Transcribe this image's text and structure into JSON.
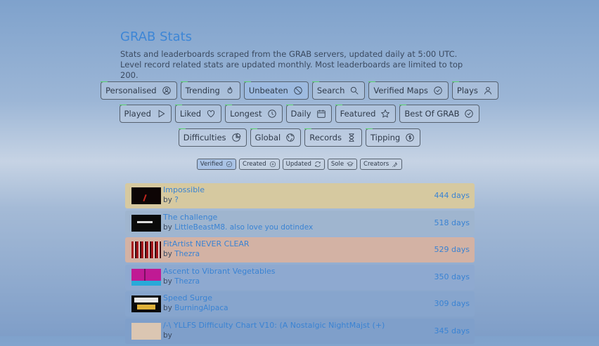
{
  "header": {
    "title": "GRAB Stats",
    "subtitle": "Stats and leaderboards scraped from the GRAB servers, updated daily at 5:00 UTC. Level record related stats are updated monthly. Most leaderboards are limited to top 200."
  },
  "nav": {
    "row1": [
      {
        "label": "Personalised",
        "icon": "user-circle-icon"
      },
      {
        "label": "Trending",
        "icon": "flame-icon"
      },
      {
        "label": "Unbeaten",
        "icon": "ban-icon",
        "active": true
      },
      {
        "label": "Search",
        "icon": "search-icon"
      },
      {
        "label": "Verified Maps",
        "icon": "check-circle-icon"
      },
      {
        "label": "Plays",
        "icon": "user-icon"
      }
    ],
    "row2": [
      {
        "label": "Played",
        "icon": "play-icon"
      },
      {
        "label": "Liked",
        "icon": "heart-icon"
      },
      {
        "label": "Longest",
        "icon": "clock-icon"
      },
      {
        "label": "Daily",
        "icon": "calendar-icon"
      },
      {
        "label": "Featured",
        "icon": "star-icon"
      },
      {
        "label": "Best Of GRAB",
        "icon": "check-circle-icon"
      }
    ],
    "row3": [
      {
        "label": "Difficulties",
        "icon": "pie-chart-icon"
      },
      {
        "label": "Global",
        "icon": "globe-icon"
      },
      {
        "label": "Records",
        "icon": "hourglass-icon"
      },
      {
        "label": "Tipping",
        "icon": "dollar-circle-icon"
      }
    ]
  },
  "filters": [
    {
      "label": "Verified",
      "icon": "check-circle-icon",
      "active": true
    },
    {
      "label": "Created",
      "icon": "plus-circle-icon"
    },
    {
      "label": "Updated",
      "icon": "refresh-icon"
    },
    {
      "label": "Sole",
      "icon": "graduation-cap-icon"
    },
    {
      "label": "Creators",
      "icon": "tools-icon"
    }
  ],
  "levels": [
    {
      "title": "Impossible",
      "by": "by",
      "creator": "?",
      "days": "444 days",
      "color": "#d6c9a0",
      "thumb": "dark-red"
    },
    {
      "title": "The challenge",
      "by": "by",
      "creator": "LittleBeastM8. also love you dotindex",
      "days": "518 days",
      "color": "#9fb5cf",
      "thumb": "black-text"
    },
    {
      "title": "FitArtist NEVER CLEAR",
      "by": "by",
      "creator": "Thezra",
      "days": "529 days",
      "color": "#d3b2a4",
      "thumb": "red-stripes"
    },
    {
      "title": "Ascent to Vibrant Vegetables",
      "by": "by",
      "creator": "Thezra",
      "days": "350 days",
      "color": "#8ea9d0",
      "thumb": "magenta"
    },
    {
      "title": "Speed Surge",
      "by": "by",
      "creator": "BurningAlpaca",
      "days": "309 days",
      "color": "#87a5cd",
      "thumb": "speed"
    },
    {
      "title": "/-\\ YLLFS Difficulty Chart V10: (A Nostalgic NightMajst (+)",
      "by": "by",
      "creator": "",
      "days": "345 days",
      "color": "#7f9fca",
      "thumb": "light"
    }
  ]
}
